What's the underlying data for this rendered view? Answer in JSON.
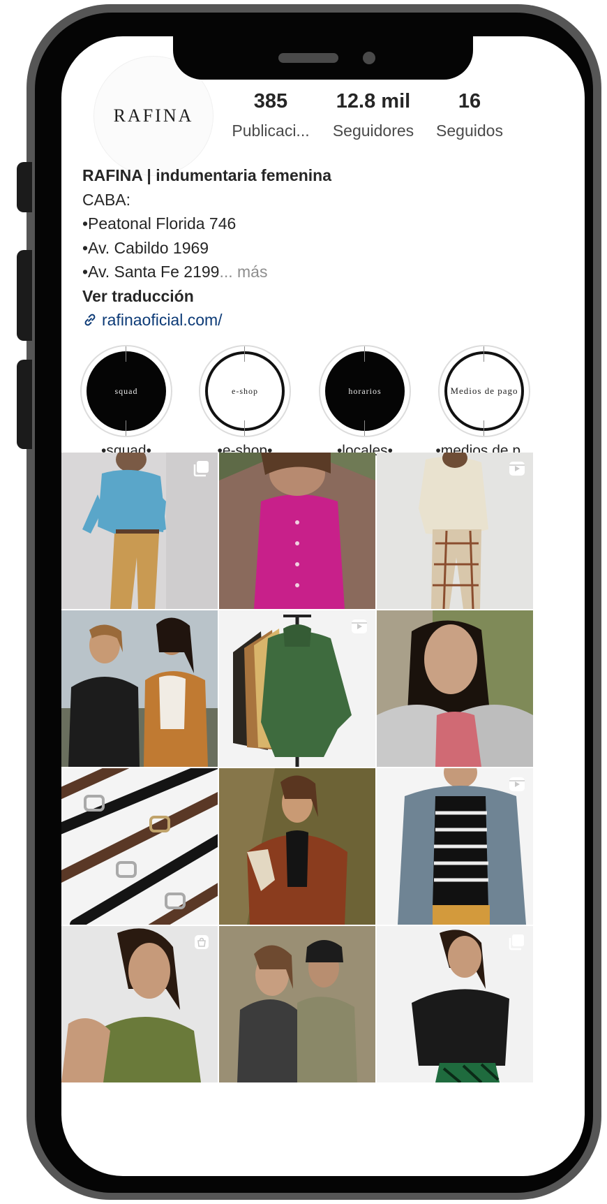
{
  "profile": {
    "avatar_logo": "RAFINA",
    "stats": [
      {
        "value": "385",
        "label": "Publicaci..."
      },
      {
        "value": "12.8 mil",
        "label": "Seguidores"
      },
      {
        "value": "16",
        "label": "Seguidos"
      }
    ],
    "bio": {
      "name": "RAFINA | indumentaria femenina",
      "lines": [
        "CABA:",
        "•Peatonal Florida 746",
        "•Av. Cabildo 1969",
        "•Av. Santa Fe 2199"
      ],
      "more": "... más",
      "translate": "Ver traducción",
      "link": "rafinaoficial.com/"
    }
  },
  "highlights": [
    {
      "cover_text": "squad",
      "label": "•squad•"
    },
    {
      "cover_text": "e-shop",
      "label": "•e-shop•"
    },
    {
      "cover_text": "horarios",
      "label": "•locales•"
    },
    {
      "cover_text": "Medios de pago",
      "label": "•medios de p..."
    }
  ],
  "posts": [
    {
      "badge": "carousel-icon"
    },
    {
      "badge": ""
    },
    {
      "badge": "reel-icon"
    },
    {
      "badge": ""
    },
    {
      "badge": "reel-icon"
    },
    {
      "badge": ""
    },
    {
      "badge": ""
    },
    {
      "badge": ""
    },
    {
      "badge": "reel-icon"
    },
    {
      "badge": "shopping-bag-icon"
    },
    {
      "badge": ""
    },
    {
      "badge": "carousel-icon"
    }
  ],
  "colors": {
    "text": "#262626",
    "secondary_text": "#8e8e8e",
    "link": "#0c3a76",
    "phone_frame": "#565656"
  }
}
